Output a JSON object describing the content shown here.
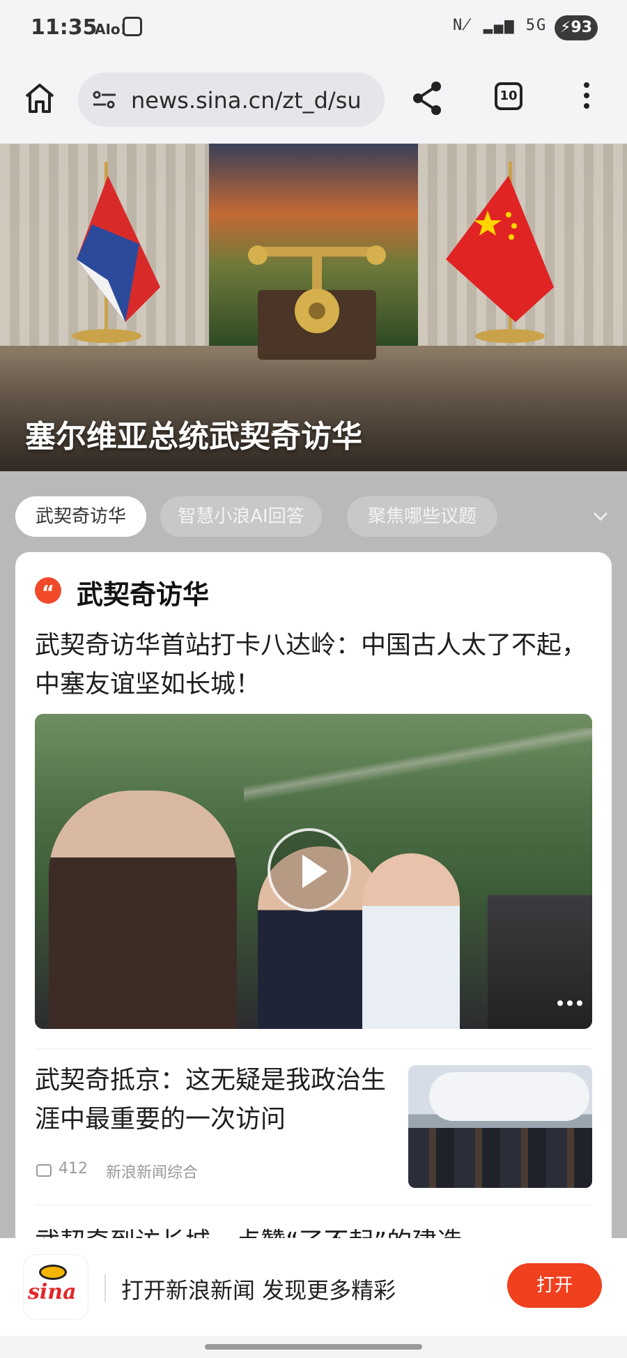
{
  "status_bar": {
    "time": "11:35",
    "aio": "AIo!",
    "signal": "N̸ ▂▄▆ 5G ▂▄▆",
    "battery": "93"
  },
  "browser": {
    "url": "news.sina.cn/zt_d/su",
    "tab_count": "10"
  },
  "hero": {
    "title": "塞尔维亚总统武契奇访华"
  },
  "chips": [
    {
      "label": "武契奇访华",
      "active": true
    },
    {
      "label": "智慧小浪AI回答",
      "active": false
    },
    {
      "label": "聚焦哪些议题",
      "active": false
    }
  ],
  "card": {
    "section_icon": "“",
    "section_title": "武契奇访华",
    "lead_headline": "武契奇访华首站打卡八达岭：中国古人太了不起，中塞友谊坚如长城！",
    "item": {
      "headline": "武契奇抵京：这无疑是我政治生涯中最重要的一次访问",
      "comments": "412",
      "source": "新浪新闻综合"
    },
    "next_headline": "武契奇到访长城，点赞“了不起”的建造"
  },
  "promo": {
    "logo_text": "sina",
    "text": "打开新浪新闻 发现更多精彩",
    "open_label": "打开"
  },
  "colors": {
    "accent": "#f0401e",
    "chip_active_bg": "#ffffff",
    "gray_bg": "#b9b9bb"
  }
}
